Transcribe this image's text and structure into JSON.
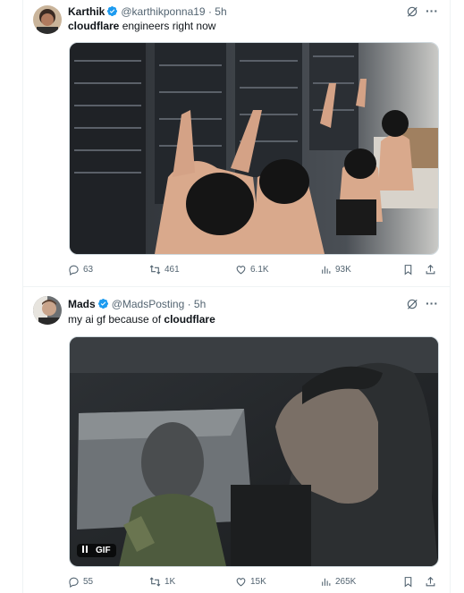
{
  "tweets": [
    {
      "name": "Karthik",
      "handle": "@karthikponna19",
      "time": "· 5h",
      "text_bold": "cloudflare",
      "text_rest": " engineers right now",
      "text_prefix": "",
      "stats": {
        "replies": "63",
        "reposts": "461",
        "likes": "6.1K",
        "views": "93K"
      }
    },
    {
      "name": "Mads",
      "handle": "@MadsPosting",
      "time": "· 5h",
      "text_prefix": "my ai gf because of ",
      "text_bold": "cloudflare",
      "text_rest": "",
      "media_badge": "GIF",
      "stats": {
        "replies": "55",
        "reposts": "1K",
        "likes": "15K",
        "views": "265K"
      }
    }
  ],
  "more_glyph": "···",
  "colors": {
    "verified": "#1d9bf0",
    "muted": "#536471",
    "border": "#eff3f4"
  },
  "icons": [
    "verified-badge-icon",
    "grok-icon",
    "more-icon",
    "reply-icon",
    "repost-icon",
    "like-icon",
    "views-icon",
    "bookmark-icon",
    "share-icon",
    "pause-icon"
  ]
}
